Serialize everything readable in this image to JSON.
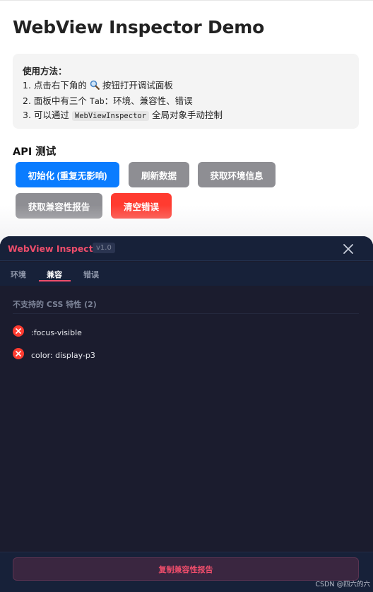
{
  "page": {
    "title": "WebView Inspector Demo"
  },
  "usage": {
    "title": "使用方法：",
    "line1_prefix": "1. 点击右下角的",
    "line1_suffix": "按钮打开调试面板",
    "line2_prefix": "2. 面板中有三个",
    "line2_tab": "Tab",
    "line2_suffix": "：环境、兼容性、错误",
    "line3_prefix": "3. 可以通过",
    "line3_code": "WebViewInspector",
    "line3_suffix": "全局对象手动控制"
  },
  "api": {
    "heading": "API 测试",
    "buttons": [
      {
        "label": "初始化 (重复无影响)",
        "color": "#0a7cff"
      },
      {
        "label": "刷新数据",
        "color": "#8e8e93"
      },
      {
        "label": "获取环境信息",
        "color": "#8e8e93"
      },
      {
        "label": "获取兼容性报告",
        "color": "#8e8e93"
      },
      {
        "label": "清空错误",
        "color": "#ff3b30"
      }
    ]
  },
  "inspector": {
    "title": "WebView Inspector",
    "version": "v1.0",
    "tabs": [
      {
        "label": "环境",
        "active": false
      },
      {
        "label": "兼容",
        "active": true
      },
      {
        "label": "错误",
        "active": false
      }
    ],
    "section_title": "不支持的 CSS 特性 (2)",
    "issues": [
      {
        "label": ":focus-visible",
        "icon": "error-x-icon"
      },
      {
        "label": "color: display-p3",
        "icon": "error-x-icon"
      }
    ],
    "copy_button": "复制兼容性报告",
    "accent_color": "#ee4d6b",
    "error_color": "#ff3b30"
  },
  "watermark": "CSDN @四六的六"
}
